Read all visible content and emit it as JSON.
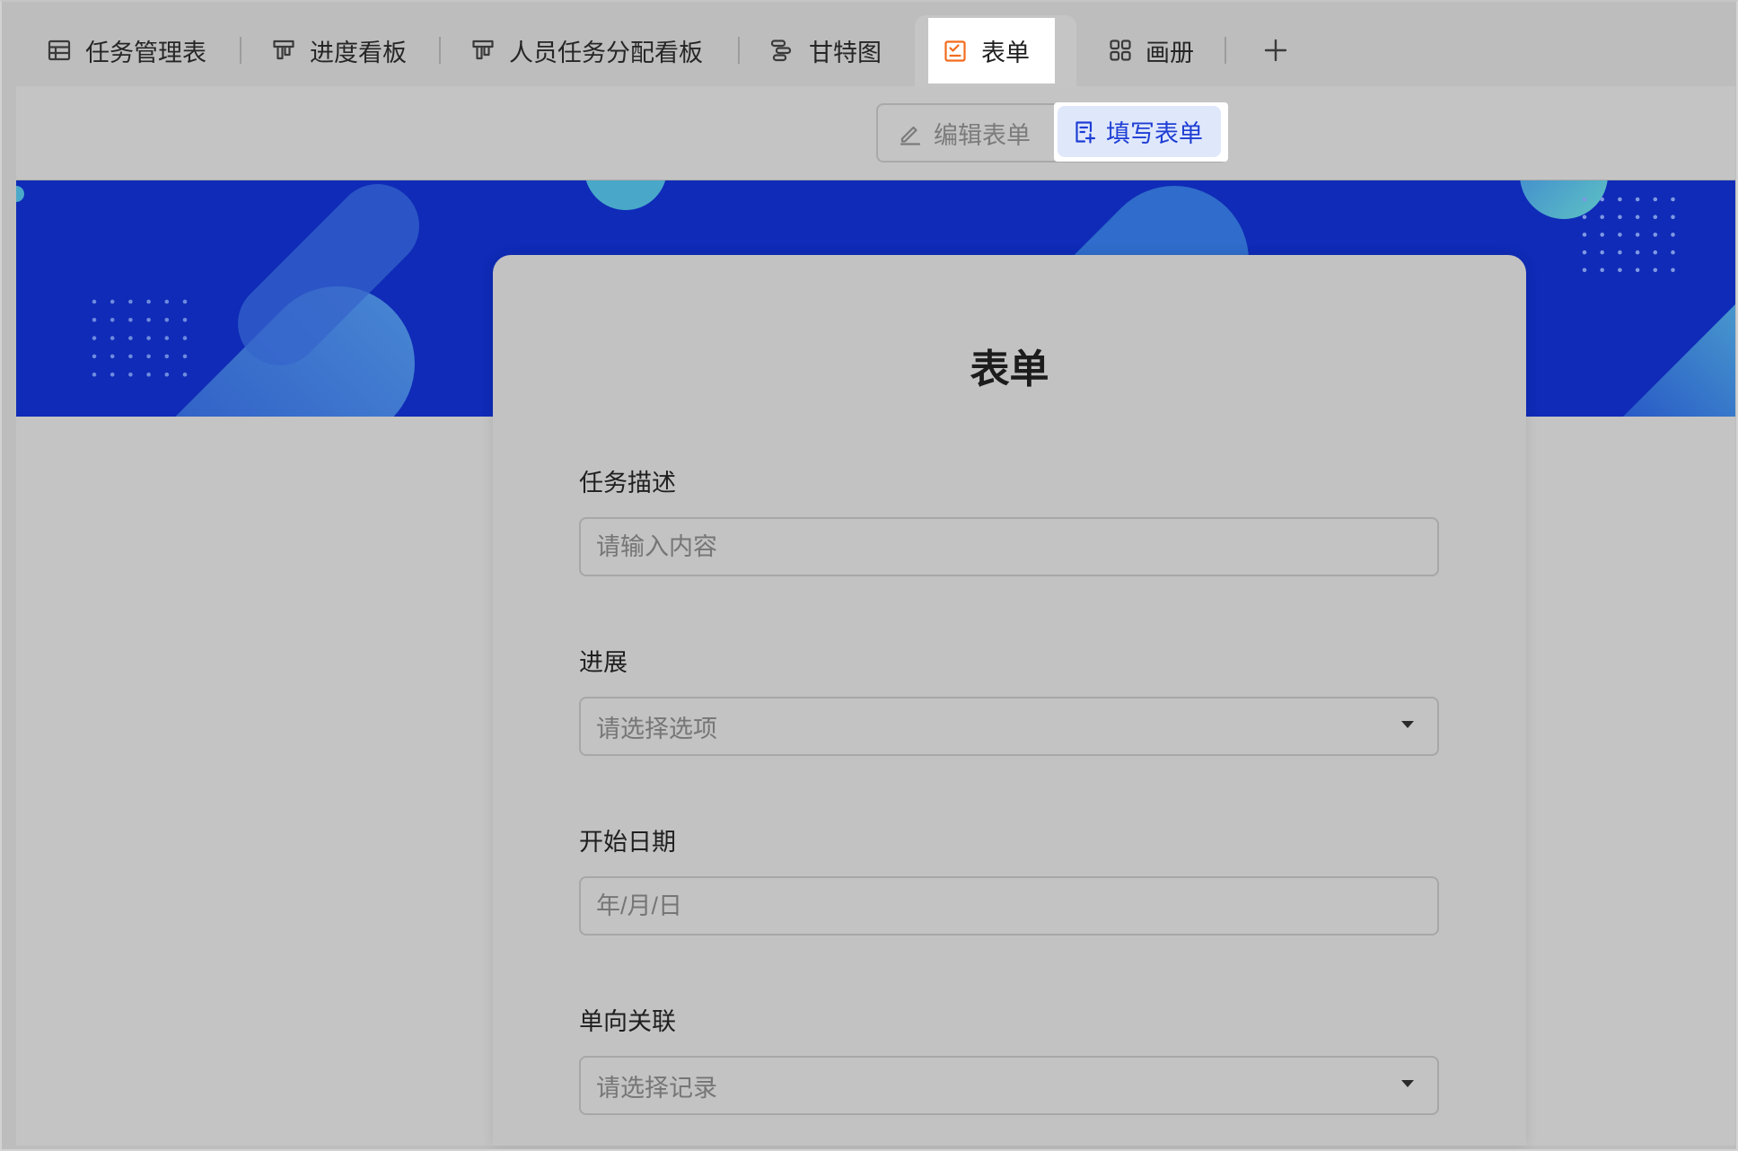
{
  "tabs": [
    {
      "label": "任务管理表",
      "icon": "table-icon"
    },
    {
      "label": "进度看板",
      "icon": "kanban-icon"
    },
    {
      "label": "人员任务分配看板",
      "icon": "kanban-icon"
    },
    {
      "label": "甘特图",
      "icon": "gantt-icon"
    },
    {
      "label": "表单",
      "icon": "form-icon",
      "active": true
    },
    {
      "label": "画册",
      "icon": "gallery-icon"
    }
  ],
  "add_view_icon": "plus-icon",
  "mode_switch": {
    "edit": {
      "label": "编辑表单",
      "icon": "pencil-icon",
      "selected": false
    },
    "fill": {
      "label": "填写表单",
      "icon": "form-fill-icon",
      "selected": true
    }
  },
  "form": {
    "title": "表单",
    "fields": [
      {
        "label": "任务描述",
        "type": "text",
        "placeholder": "请输入内容"
      },
      {
        "label": "进展",
        "type": "select",
        "placeholder": "请选择选项",
        "icon": "caret-down-icon"
      },
      {
        "label": "开始日期",
        "type": "date",
        "placeholder": "年/月/日"
      },
      {
        "label": "单向关联",
        "type": "select",
        "placeholder": "请选择记录",
        "icon": "caret-down-icon"
      }
    ]
  },
  "colors": {
    "banner": "#0f2bb7",
    "accent_blue": "#1d3ed4",
    "active_tab_icon": "#f26b1d",
    "fill_button_bg": "#dfe7fb",
    "overlay_mask": "#bdbdbd"
  }
}
